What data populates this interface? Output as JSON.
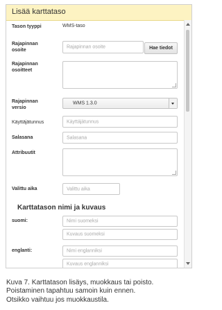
{
  "dialog": {
    "title": "Lisää karttataso",
    "fields": {
      "layer_type": {
        "label": "Tason tyyppi",
        "value": "WMS-taso"
      },
      "api_url": {
        "label": "Rajapinnan osoite",
        "placeholder": "Rajapinnan osoite",
        "button_label": "Hae tiedot"
      },
      "api_urls": {
        "label": "Rajapinnan osoitteet"
      },
      "api_version": {
        "label": "Rajapinnan versio",
        "value": "WMS 1.3.0"
      },
      "username": {
        "label": "Käyttäjätunnus",
        "placeholder": "Käyttäjätunnus"
      },
      "password": {
        "label": "Salasana",
        "placeholder": "Salasana"
      },
      "attributes": {
        "label": "Attribuutit"
      },
      "selected_time": {
        "label": "Valittu aika",
        "placeholder": "Valittu aika"
      }
    },
    "name_section": {
      "title": "Karttatason nimi ja kuvaus",
      "languages": [
        {
          "label": "suomi:",
          "name_placeholder": "Nimi suomeksi",
          "desc_placeholder": "Kuvaus suomeksi"
        },
        {
          "label": "englanti:",
          "name_placeholder": "Nimi englanniksi",
          "desc_placeholder": "Kuvaus englanniksi"
        }
      ]
    }
  },
  "caption": {
    "lines": [
      "Kuva 7. Karttatason lisäys, muokkaus tai poisto.",
      "Poistaminen tapahtuu samoin kuin ennen.",
      "Otsikko vaihtuu jos muokkaustila."
    ]
  }
}
